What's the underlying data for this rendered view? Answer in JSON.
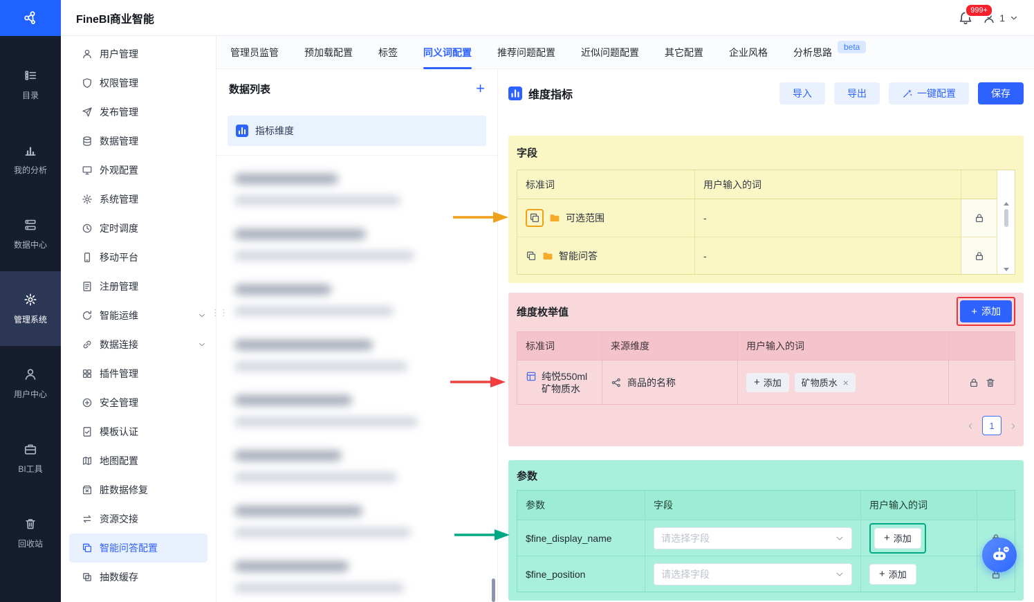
{
  "colors": {
    "accent": "#2e62ff",
    "rail_bg": "#161d2e",
    "fields_section_bg": "#fbf7c5",
    "enum_section_bg": "#f9d8dc",
    "params_section_bg": "#a9f0dc",
    "annotation_orange": "#efa11a",
    "annotation_red": "#e8383d",
    "annotation_green": "#00a884",
    "notification_badge_bg": "#f5222d"
  },
  "glyphs": {
    "plus": "+",
    "close": "×",
    "chevron_left": "‹",
    "chevron_right": "›",
    "drag": "⋮⋮"
  },
  "topbar": {
    "app_title": "FineBI商业智能",
    "notification_count": "999+",
    "user_label": "1"
  },
  "rail": {
    "items": [
      {
        "label": "目录",
        "icon": "catalog-icon"
      },
      {
        "label": "我的分析",
        "icon": "my-analysis-icon"
      },
      {
        "label": "数据中心",
        "icon": "data-center-icon"
      },
      {
        "label": "管理系统",
        "icon": "admin-system-icon",
        "active": true
      },
      {
        "label": "用户中心",
        "icon": "user-center-icon"
      },
      {
        "label": "BI工具",
        "icon": "bi-tools-icon"
      },
      {
        "label": "回收站",
        "icon": "recycle-bin-icon"
      }
    ]
  },
  "admin_menu": {
    "items": [
      {
        "label": "用户管理",
        "icon": "user-icon"
      },
      {
        "label": "权限管理",
        "icon": "shield-icon"
      },
      {
        "label": "发布管理",
        "icon": "send-icon"
      },
      {
        "label": "数据管理",
        "icon": "database-icon"
      },
      {
        "label": "外观配置",
        "icon": "monitor-icon"
      },
      {
        "label": "系统管理",
        "icon": "gear-icon"
      },
      {
        "label": "定时调度",
        "icon": "clock-icon"
      },
      {
        "label": "移动平台",
        "icon": "phone-icon"
      },
      {
        "label": "注册管理",
        "icon": "document-icon"
      },
      {
        "label": "智能运维",
        "icon": "refresh-icon",
        "expandable": true
      },
      {
        "label": "数据连接",
        "icon": "link-icon",
        "expandable": true
      },
      {
        "label": "插件管理",
        "icon": "plugin-icon"
      },
      {
        "label": "安全管理",
        "icon": "security-icon"
      },
      {
        "label": "模板认证",
        "icon": "doc-check-icon"
      },
      {
        "label": "地图配置",
        "icon": "map-icon"
      },
      {
        "label": "脏数据修复",
        "icon": "repair-icon"
      },
      {
        "label": "资源交接",
        "icon": "swap-icon"
      },
      {
        "label": "智能问答配置",
        "icon": "copy-icon",
        "active": true
      },
      {
        "label": "抽数缓存",
        "icon": "layers-icon"
      }
    ]
  },
  "tabs": [
    {
      "label": "管理员监管"
    },
    {
      "label": "预加载配置"
    },
    {
      "label": "标签"
    },
    {
      "label": "同义词配置",
      "active": true
    },
    {
      "label": "推荐问题配置"
    },
    {
      "label": "近似问题配置"
    },
    {
      "label": "其它配置"
    },
    {
      "label": "企业风格"
    },
    {
      "label": "分析思路",
      "badge": "beta"
    }
  ],
  "data_list": {
    "title": "数据列表",
    "selected_item": "指标维度"
  },
  "editor": {
    "title": "维度指标",
    "buttons": {
      "import": "导入",
      "export": "导出",
      "one_click": "一键配置",
      "save": "保存"
    }
  },
  "fields_section": {
    "title": "字段",
    "columns": {
      "standard": "标准词",
      "user_words": "用户输入的词"
    },
    "rows": [
      {
        "standard": "可选范围",
        "user_words": "-"
      },
      {
        "standard": "智能问答",
        "user_words": "-"
      }
    ]
  },
  "enum_section": {
    "title": "维度枚举值",
    "add_button": "添加",
    "columns": {
      "standard": "标准词",
      "source": "来源维度",
      "user_words": "用户输入的词"
    },
    "rows": [
      {
        "standard": "纯悦550ml矿物质水",
        "source": "商品的名称",
        "add_label": "添加",
        "tags": [
          "矿物质水"
        ]
      }
    ],
    "pagination": {
      "current": "1"
    }
  },
  "params_section": {
    "title": "参数",
    "columns": {
      "param": "参数",
      "field": "字段",
      "user_words": "用户输入的词"
    },
    "rows": [
      {
        "param": "$fine_display_name",
        "field_placeholder": "请选择字段",
        "add_label": "添加"
      },
      {
        "param": "$fine_position",
        "field_placeholder": "请选择字段",
        "add_label": "添加"
      }
    ]
  }
}
